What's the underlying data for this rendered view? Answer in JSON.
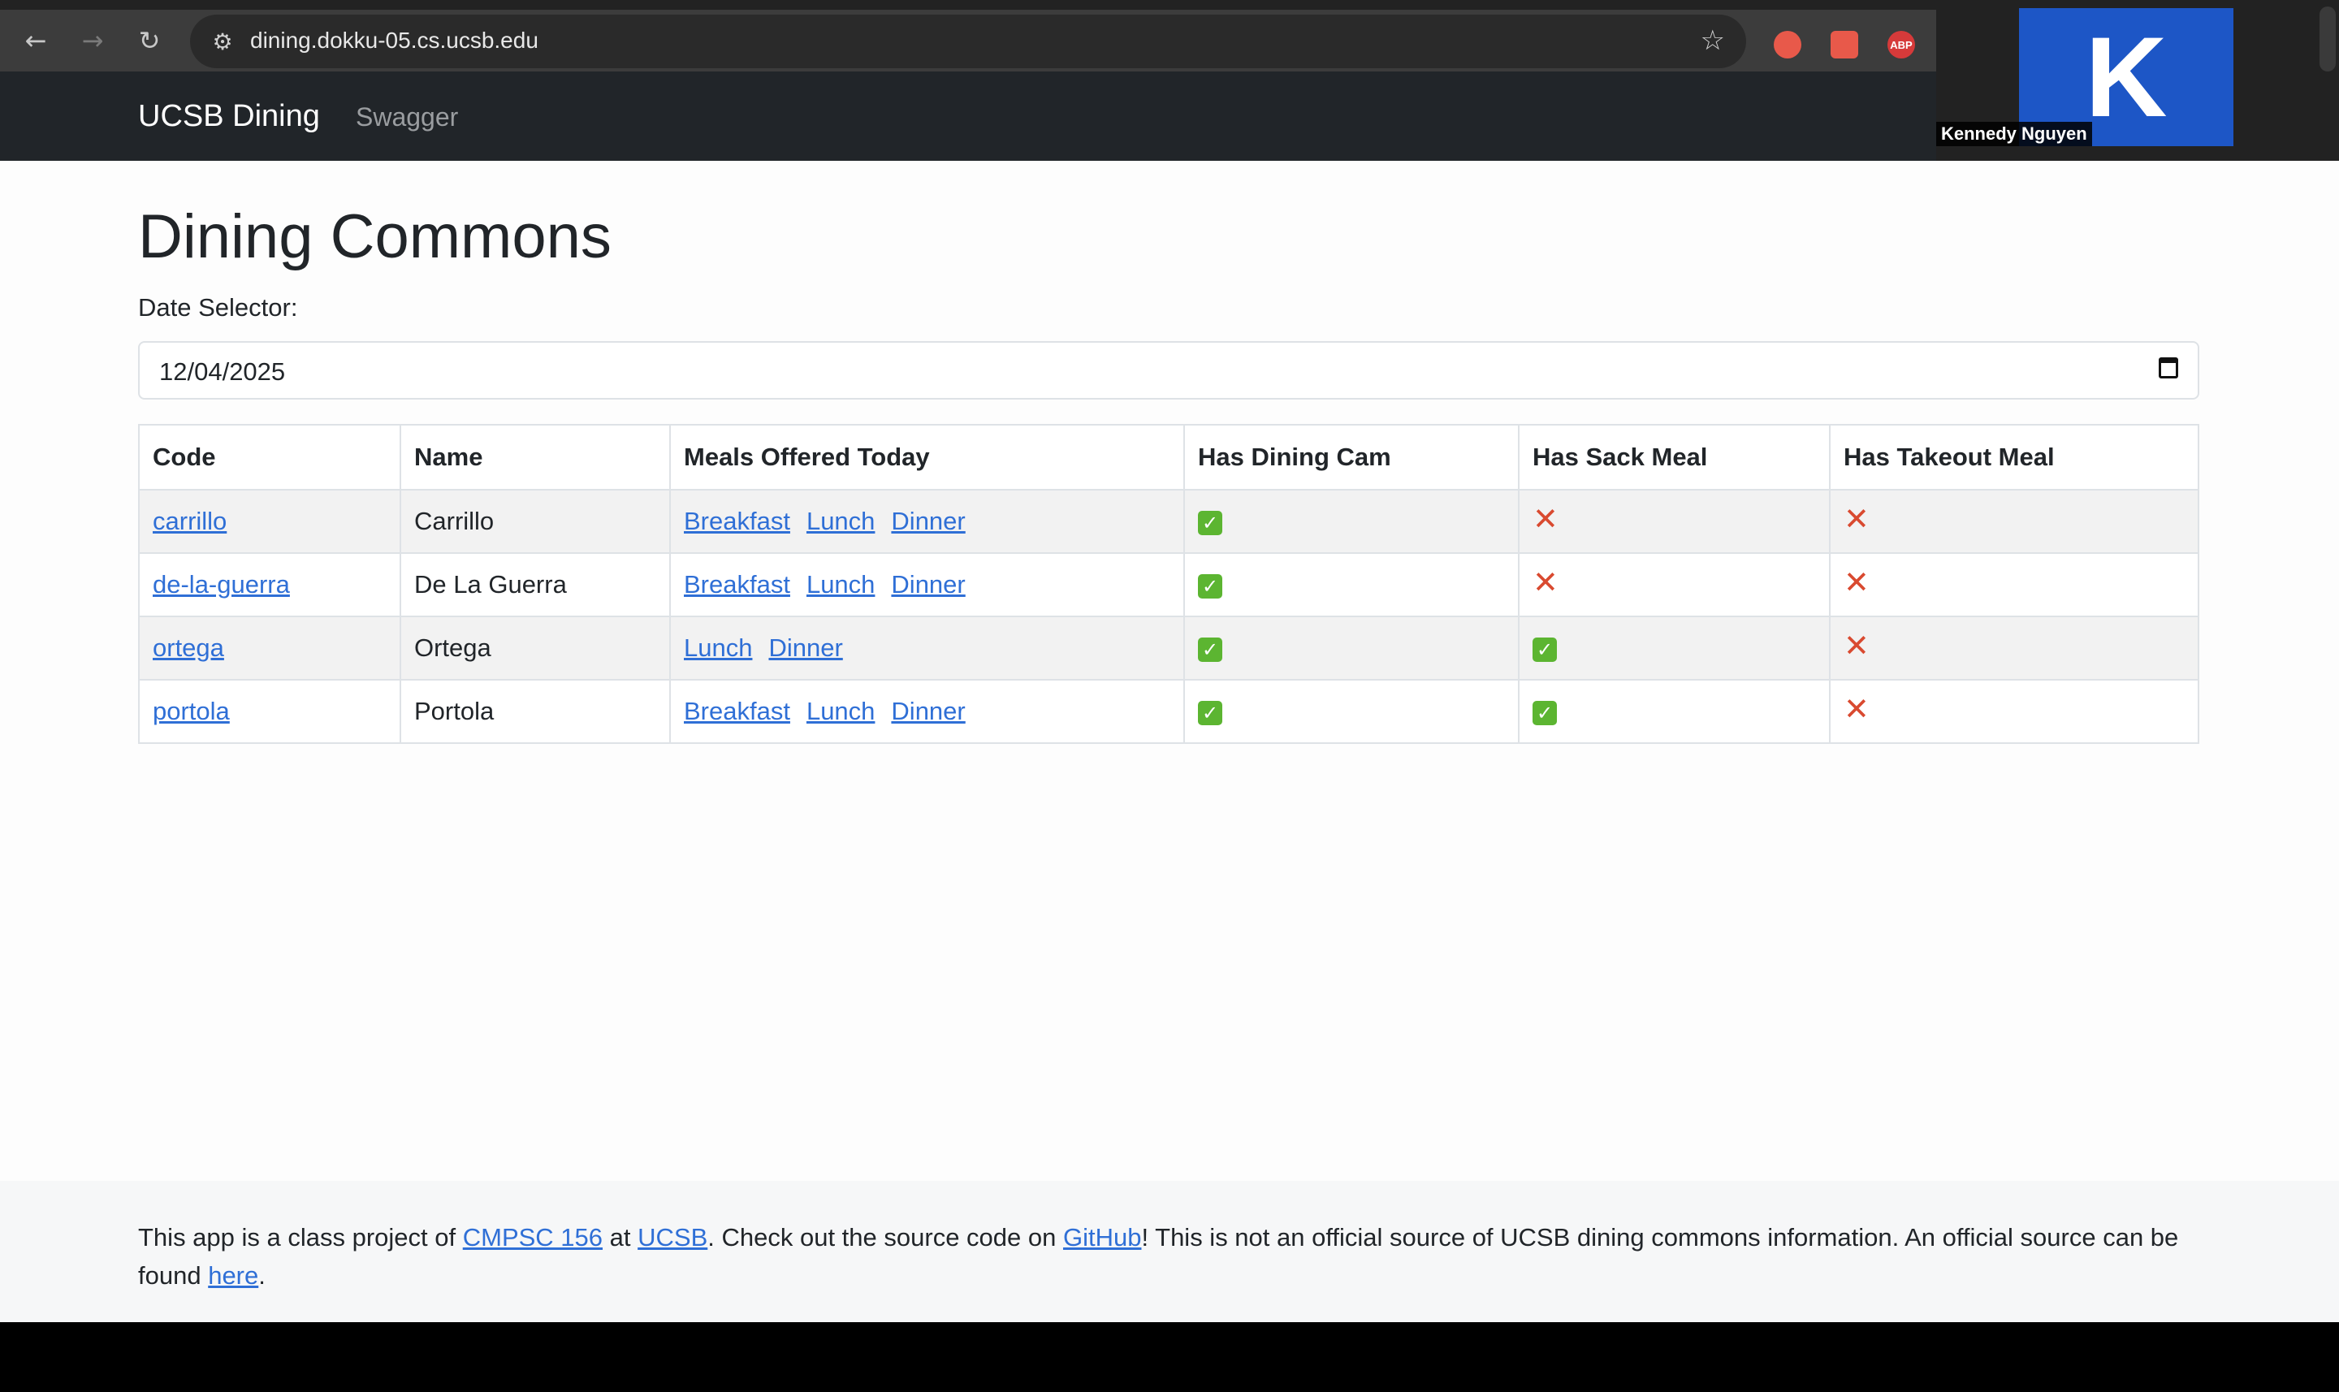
{
  "browser": {
    "url": "dining.dokku-05.cs.ucsb.edu",
    "back_icon": "←",
    "forward_icon": "→",
    "reload_icon": "↻",
    "site_info_icon": "⚙",
    "star_icon": "☆",
    "extensions": [
      "ABP"
    ]
  },
  "video": {
    "initial": "K",
    "name": "Kennedy Nguyen"
  },
  "navbar": {
    "brand": "UCSB Dining",
    "link": "Swagger"
  },
  "page": {
    "title": "Dining Commons",
    "date_label": "Date Selector:",
    "date_value": "12/04/2025"
  },
  "table": {
    "headers": [
      "Code",
      "Name",
      "Meals Offered Today",
      "Has Dining Cam",
      "Has Sack Meal",
      "Has Takeout Meal"
    ],
    "rows": [
      {
        "code": "carrillo",
        "name": "Carrillo",
        "meals": [
          "Breakfast",
          "Lunch",
          "Dinner"
        ],
        "cam": "yes",
        "sack": "no",
        "takeout": "no"
      },
      {
        "code": "de-la-guerra",
        "name": "De La Guerra",
        "meals": [
          "Breakfast",
          "Lunch",
          "Dinner"
        ],
        "cam": "yes",
        "sack": "no",
        "takeout": "no"
      },
      {
        "code": "ortega",
        "name": "Ortega",
        "meals": [
          "Lunch",
          "Dinner"
        ],
        "cam": "yes",
        "sack": "yes",
        "takeout": "no"
      },
      {
        "code": "portola",
        "name": "Portola",
        "meals": [
          "Breakfast",
          "Lunch",
          "Dinner"
        ],
        "cam": "yes",
        "sack": "yes",
        "takeout": "no"
      }
    ],
    "check_glyph": "✓",
    "cross_glyph": "✕"
  },
  "footer": {
    "t1": "This app is a class project of ",
    "link1": "CMPSC 156",
    "t2": " at ",
    "link2": "UCSB",
    "t3": ". Check out the source code on ",
    "link3": "GitHub",
    "t4": "! This is not an official source of UCSB dining commons information. An official source can be found ",
    "link4": "here",
    "t5": "."
  },
  "colors": {
    "navbar_bg": "#212529",
    "link": "#2f6fd6",
    "check": "#5cb531",
    "cross": "#d94a30",
    "avatar": "#1d56c6"
  }
}
